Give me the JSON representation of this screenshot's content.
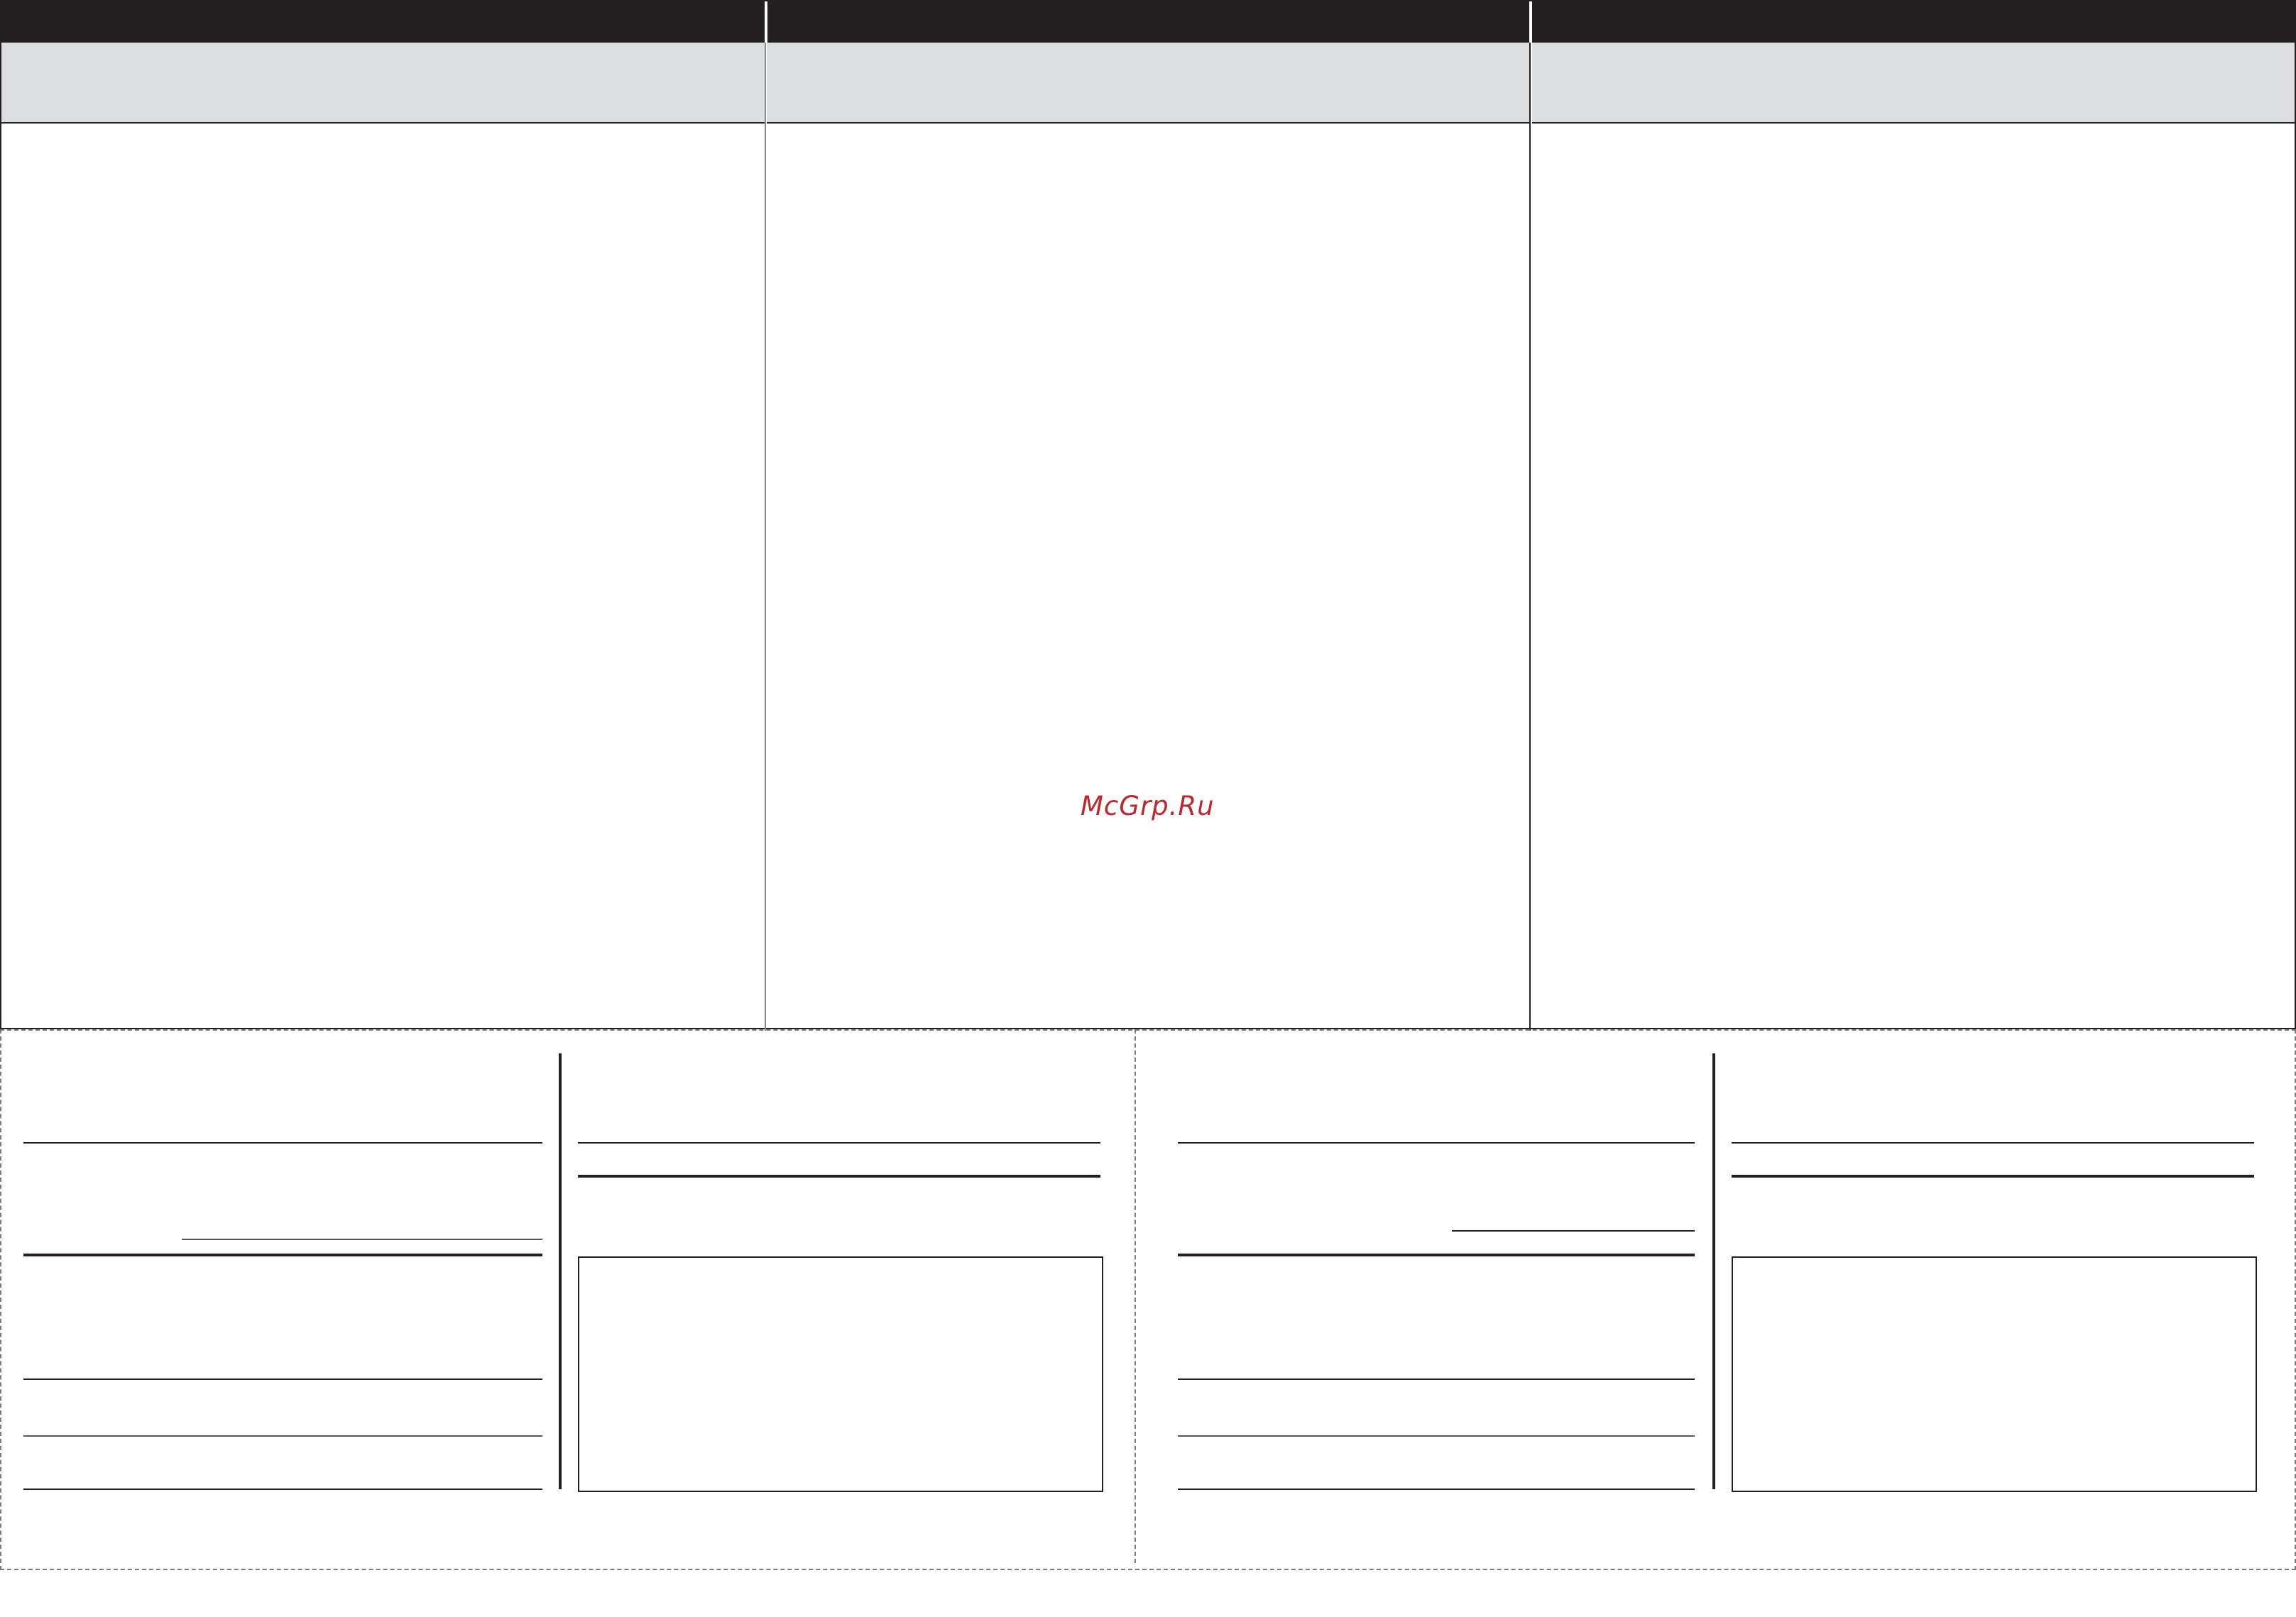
{
  "watermark": {
    "text": "McGrp.Ru",
    "color": "#c0272d"
  },
  "colors": {
    "header_dark": "#231f20",
    "header_grey": "#dcdddf",
    "line": "#231f20",
    "dashed_border": "#7a7a7a"
  },
  "top_table": {
    "columns": 3
  },
  "coupons": {
    "count": 2
  }
}
